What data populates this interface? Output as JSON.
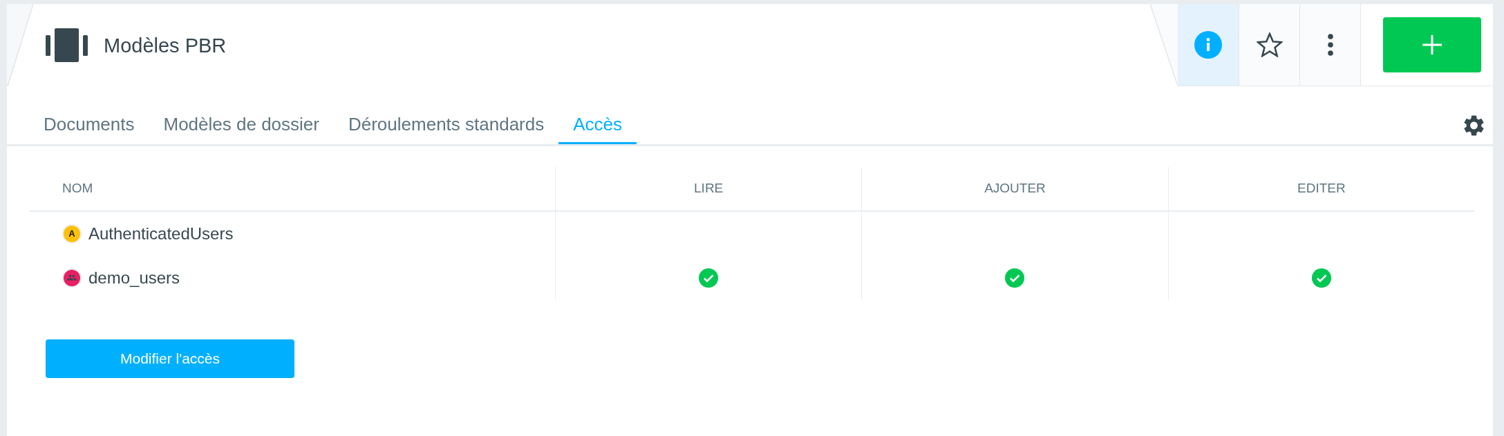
{
  "header": {
    "title": "Modèles PBR",
    "info_selected": true,
    "starred": false
  },
  "tabs": [
    {
      "label": "Documents",
      "selected": false
    },
    {
      "label": "Modèles de dossier",
      "selected": false
    },
    {
      "label": "Déroulements standards",
      "selected": false
    },
    {
      "label": "Accès",
      "selected": true
    }
  ],
  "table": {
    "columns": [
      "NOM",
      "LIRE",
      "AJOUTER",
      "EDITER"
    ],
    "rows": [
      {
        "name": "AuthenticatedUsers",
        "avatar": {
          "kind": "initial",
          "initial": "A",
          "color": "#ffc107"
        },
        "permissions": [
          {
            "checked": false
          },
          {
            "checked": false
          },
          {
            "checked": false
          }
        ]
      },
      {
        "name": "demo_users",
        "avatar": {
          "kind": "group",
          "color": "#e91e63"
        },
        "permissions": [
          {
            "checked": true
          },
          {
            "checked": true
          },
          {
            "checked": true
          }
        ]
      }
    ]
  },
  "buttons": [
    "Modifier l'accès"
  ]
}
